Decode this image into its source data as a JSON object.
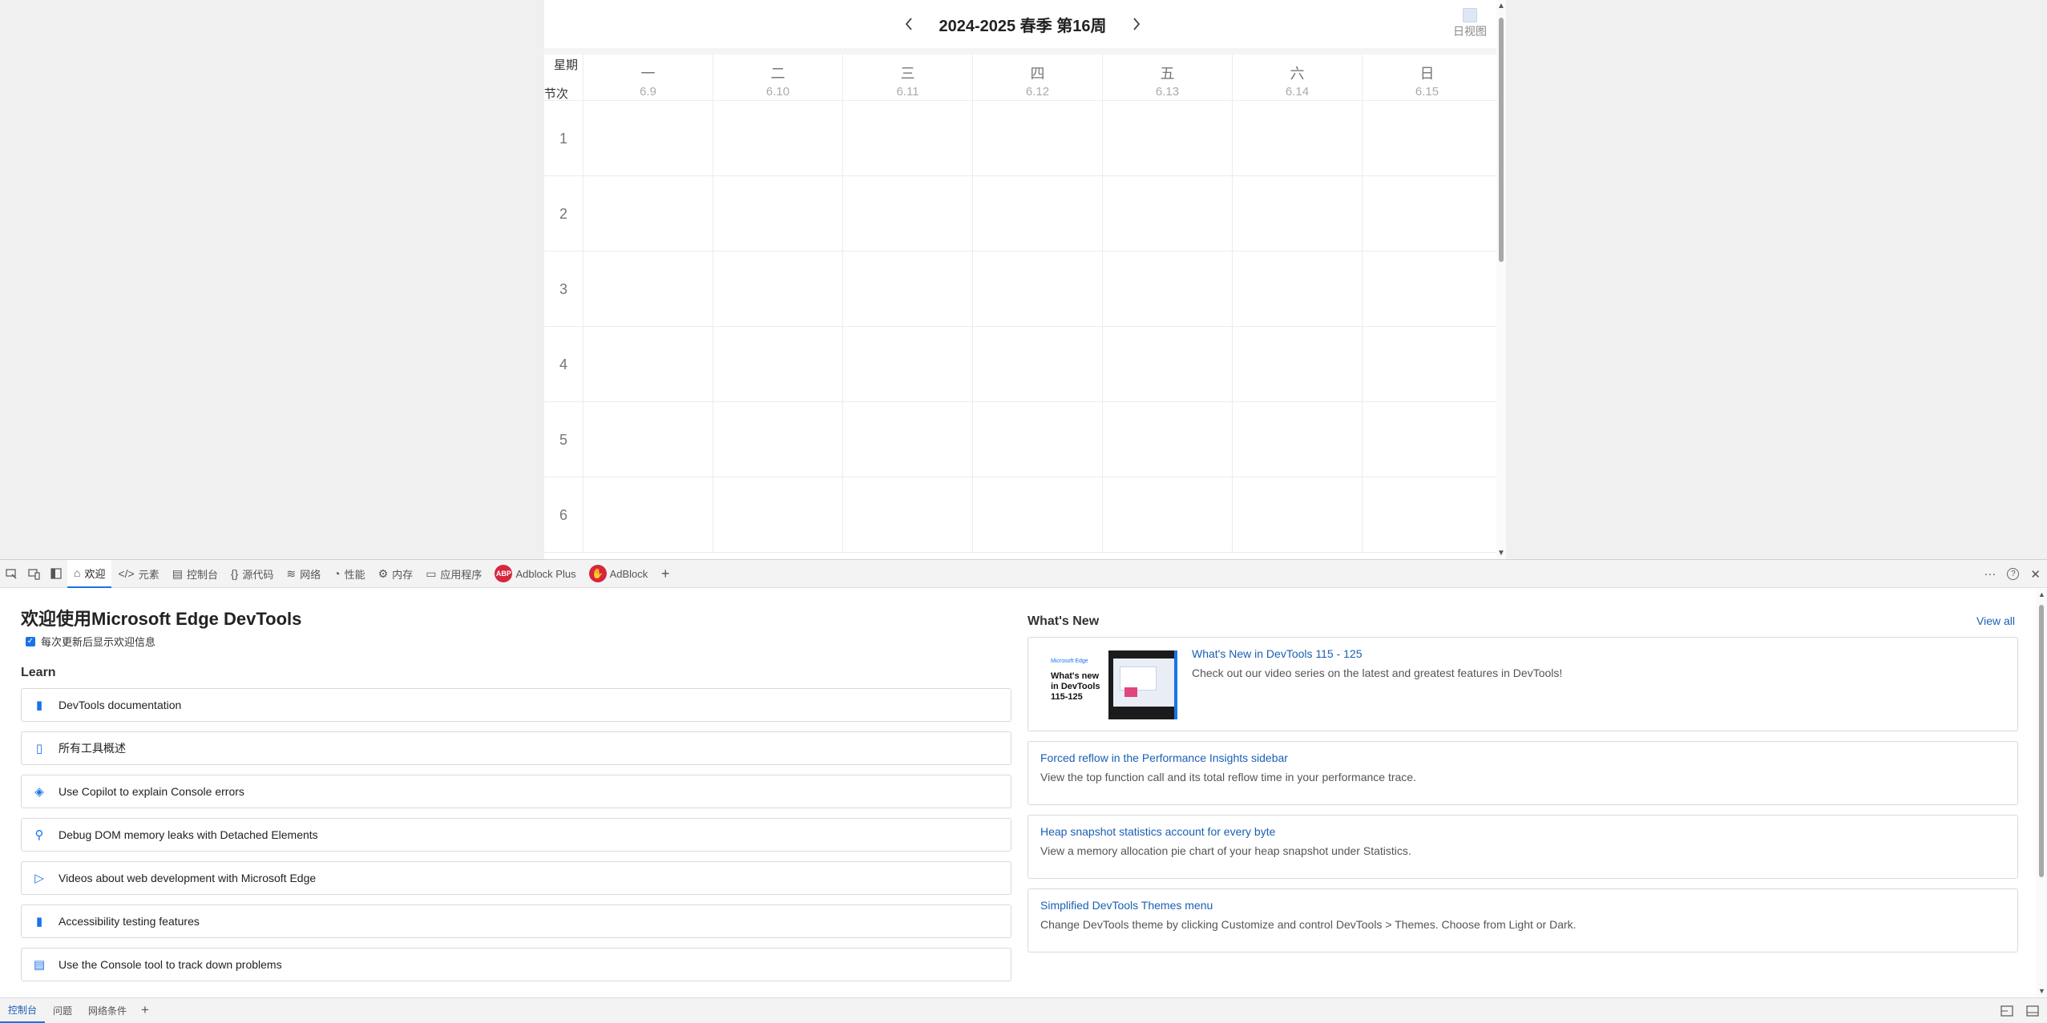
{
  "schedule": {
    "title": "2024-2025 春季 第16周",
    "prev_icon": "‹",
    "next_icon": "›",
    "day_view_label": "日视图",
    "corner_day": "星期",
    "corner_period": "节次",
    "days": [
      {
        "name": "一",
        "date": "6.9"
      },
      {
        "name": "二",
        "date": "6.10"
      },
      {
        "name": "三",
        "date": "6.11"
      },
      {
        "name": "四",
        "date": "6.12"
      },
      {
        "name": "五",
        "date": "6.13"
      },
      {
        "name": "六",
        "date": "6.14"
      },
      {
        "name": "日",
        "date": "6.15"
      }
    ],
    "periods": [
      "1",
      "2",
      "3",
      "4",
      "5",
      "6"
    ]
  },
  "devtools": {
    "tabs": [
      {
        "label": "欢迎",
        "icon": "⌂",
        "active": true
      },
      {
        "label": "元素",
        "icon": "</>"
      },
      {
        "label": "控制台",
        "icon": "▤"
      },
      {
        "label": "源代码",
        "icon": "{}"
      },
      {
        "label": "网络",
        "icon": "≋"
      },
      {
        "label": "性能",
        "icon": "◔"
      },
      {
        "label": "内存",
        "icon": "⚙"
      },
      {
        "label": "应用程序",
        "icon": "▭"
      },
      {
        "label": "Adblock Plus",
        "icon": "ABP"
      },
      {
        "label": "AdBlock",
        "icon": "✋"
      }
    ],
    "add_tab_icon": "+",
    "more_icon": "···",
    "help_icon": "?",
    "close_icon": "✕",
    "welcome": {
      "title": "欢迎使用Microsoft Edge DevTools",
      "checkbox_label": "每次更新后显示欢迎信息",
      "learn_title": "Learn",
      "learn_items": [
        {
          "icon": "▮",
          "label": "DevTools documentation"
        },
        {
          "icon": "▯",
          "label": "所有工具概述"
        },
        {
          "icon": "◈",
          "label": "Use Copilot to explain Console errors"
        },
        {
          "icon": "⚲",
          "label": "Debug DOM memory leaks with Detached Elements"
        },
        {
          "icon": "▷",
          "label": "Videos about web development with Microsoft Edge"
        },
        {
          "icon": "▮",
          "label": "Accessibility testing features"
        },
        {
          "icon": "▤",
          "label": "Use the Console tool to track down problems"
        }
      ],
      "whats_new_title": "What's New",
      "view_all": "View all",
      "news": [
        {
          "title": "What's New in DevTools 115 - 125",
          "desc": "Check out our video series on the latest and greatest features in DevTools!",
          "thumb_brand": "Microsoft Edge",
          "thumb_text": "What's new in DevTools 115-125"
        },
        {
          "title": "Forced reflow in the Performance Insights sidebar",
          "desc": "View the top function call and its total reflow time in your performance trace."
        },
        {
          "title": "Heap snapshot statistics account for every byte",
          "desc": "View a memory allocation pie chart of your heap snapshot under Statistics."
        },
        {
          "title": "Simplified DevTools Themes menu",
          "desc": "Change DevTools theme by clicking Customize and control DevTools > Themes. Choose from Light or Dark."
        }
      ]
    },
    "drawer_tabs": [
      {
        "label": "控制台",
        "active": true
      },
      {
        "label": "问题"
      },
      {
        "label": "网络条件"
      }
    ],
    "drawer_add_icon": "+"
  }
}
